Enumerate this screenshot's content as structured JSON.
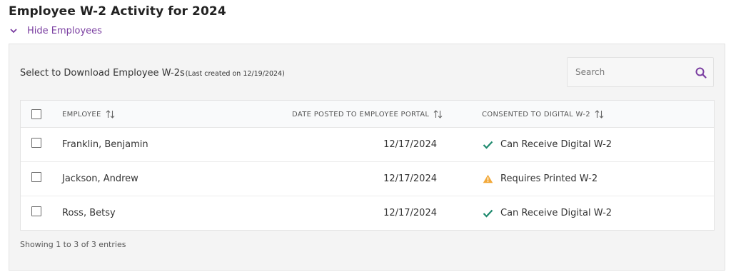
{
  "page": {
    "title": "Employee W-2 Activity for 2024",
    "toggle_label": "Hide Employees"
  },
  "panel": {
    "heading": "Select to Download Employee W-2s",
    "subheading": "(Last created on 12/19/2024)",
    "search_placeholder": "Search"
  },
  "table": {
    "columns": {
      "employee": "EMPLOYEE",
      "date_posted": "DATE POSTED TO EMPLOYEE PORTAL",
      "consent": "CONSENTED TO DIGITAL W-2"
    },
    "rows": [
      {
        "name": "Franklin, Benjamin",
        "date": "12/17/2024",
        "consent": "Can Receive Digital W-2",
        "status_icon": "check-icon"
      },
      {
        "name": "Jackson, Andrew",
        "date": "12/17/2024",
        "consent": "Requires Printed W-2",
        "status_icon": "warning-icon"
      },
      {
        "name": "Ross, Betsy",
        "date": "12/17/2024",
        "consent": "Can Receive Digital W-2",
        "status_icon": "check-icon"
      }
    ]
  },
  "footer": {
    "info": "Showing 1 to 3 of 3 entries"
  },
  "colors": {
    "accent": "#7a3ea1",
    "check": "#1e8a6e",
    "warning": "#f2a93b"
  }
}
